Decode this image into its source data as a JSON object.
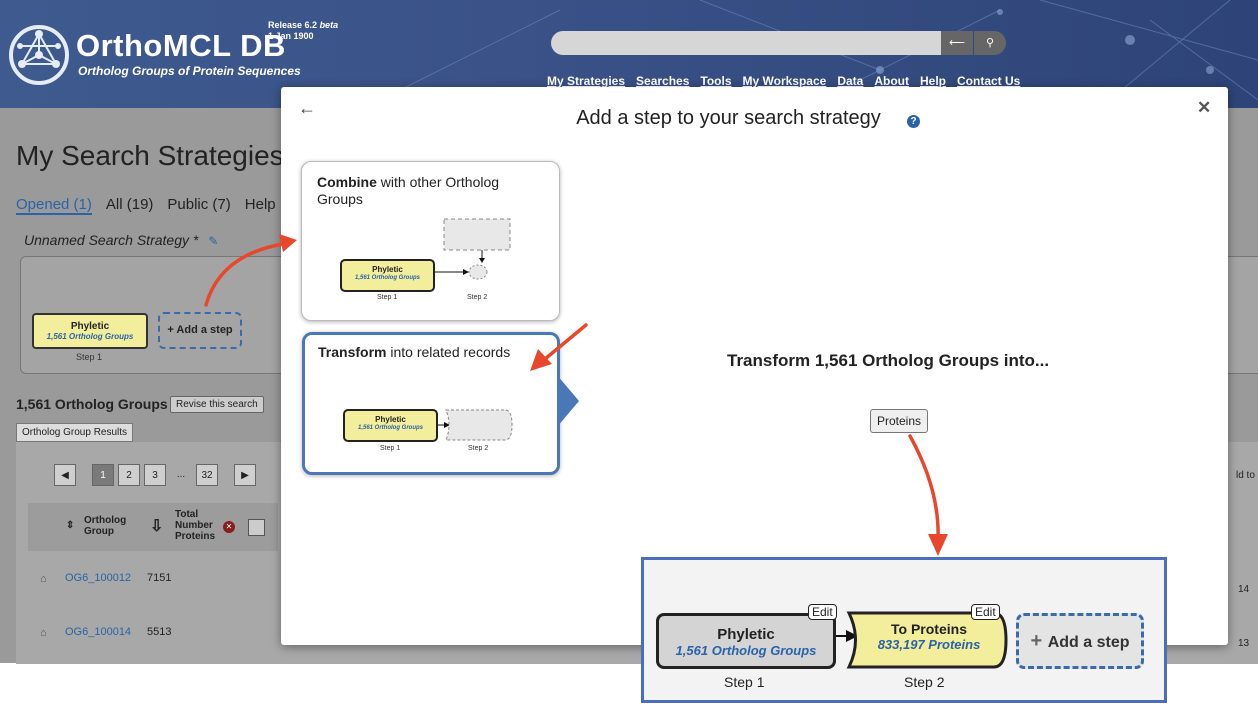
{
  "header": {
    "brand": "OrthoMCL DB",
    "tagline": "Ortholog Groups of Protein Sequences",
    "release": "Release 6.2",
    "release_tag": "beta",
    "release_date": "1 Jan 1900",
    "search_btn_back": "⟵",
    "search_btn_go": "⚲",
    "nav": [
      "My Strategies",
      "Searches",
      "Tools",
      "My Workspace",
      "Data",
      "About",
      "Help",
      "Contact Us"
    ]
  },
  "page": {
    "title": "My Search Strategies",
    "tabs": [
      "Opened (1)",
      "All (19)",
      "Public (7)",
      "Help"
    ],
    "strategy_name": "Unnamed Search Strategy *",
    "step1": {
      "title": "Phyletic",
      "subtitle": "1,561 Ortholog Groups",
      "label": "Step 1"
    },
    "add_step": "Add a step",
    "results_title": "1,561 Ortholog Groups",
    "revise_button": "Revise this search",
    "results_tab": "Ortholog Group Results",
    "pager": [
      "◀",
      "1",
      "2",
      "3",
      "...",
      "32",
      "▶"
    ],
    "columns": [
      "Ortholog Group",
      "Total Number Proteins"
    ],
    "rows": [
      {
        "group": "OG6_100012",
        "total": "7151"
      },
      {
        "group": "OG6_100014",
        "total": "5513"
      }
    ],
    "right_fragments": [
      "ld to",
      "14",
      "13"
    ]
  },
  "modal": {
    "title": "Add a step to your search strategy",
    "back_icon": "←",
    "close_icon": "✕",
    "help_icon": "?",
    "combine_card": {
      "title_bold": "Combine",
      "title_rest": " with other Ortholog Groups",
      "step1_title": "Phyletic",
      "step1_sub": "1,561 Ortholog Groups",
      "step1_label": "Step 1",
      "step2_label": "Step 2"
    },
    "transform_card": {
      "title_bold": "Transform",
      "title_rest": " into related records",
      "step1_title": "Phyletic",
      "step1_sub": "1,561 Ortholog Groups",
      "step1_label": "Step 1",
      "step2_label": "Step 2"
    },
    "transform_heading": "Transform 1,561 Ortholog Groups into...",
    "proteins_button": "Proteins"
  },
  "callout": {
    "step1": {
      "title": "Phyletic",
      "subtitle": "1,561 Ortholog Groups",
      "label": "Step 1",
      "edit": "Edit"
    },
    "step2": {
      "title": "To Proteins",
      "subtitle": "833,197 Proteins",
      "label": "Step 2",
      "edit": "Edit"
    },
    "add_step": "Add a step"
  },
  "colors": {
    "header_bg": "#3e5a8e",
    "step_yellow": "#f3ee9c",
    "accent_blue": "#2a63a8",
    "arrow_red": "#e8472c",
    "highlight_border": "#4a78b6"
  }
}
